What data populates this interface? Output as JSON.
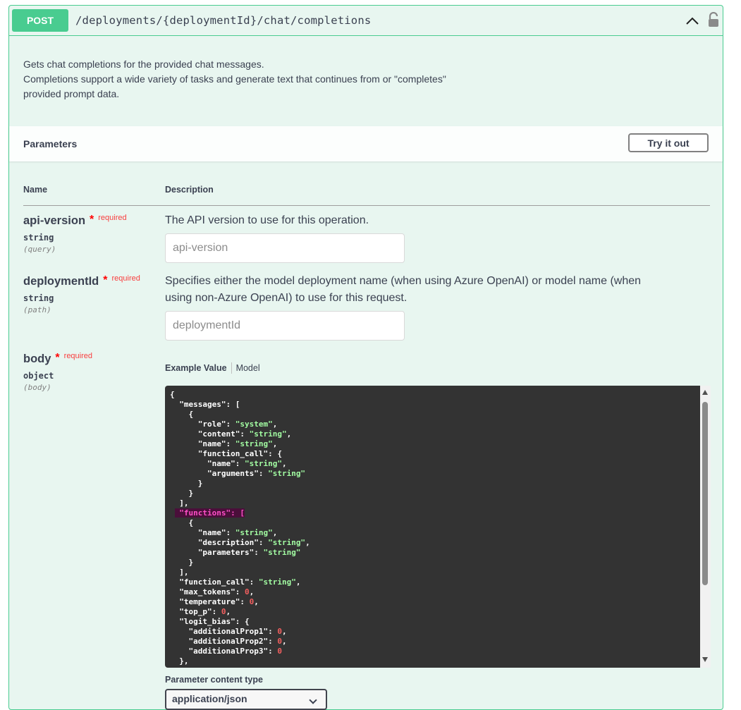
{
  "operation": {
    "method": "POST",
    "path": "/deployments/{deploymentId}/chat/completions",
    "description_lines": [
      "Gets chat completions for the provided chat messages.",
      "Completions support a wide variety of tasks and generate text that continues from or \"completes\"",
      "provided prompt data."
    ]
  },
  "parameters": {
    "title": "Parameters",
    "try_it_out_label": "Try it out",
    "col_name": "Name",
    "col_description": "Description",
    "required_star": "*",
    "required_label": "required",
    "items": [
      {
        "name": "api-version",
        "type": "string",
        "in": "(query)",
        "description": "The API version to use for this operation.",
        "placeholder": "api-version"
      },
      {
        "name": "deploymentId",
        "type": "string",
        "in": "(path)",
        "description_lines": [
          "Specifies either the model deployment name (when using Azure OpenAI) or model name (when",
          "using non-Azure OpenAI) to use for this request."
        ],
        "placeholder": "deploymentId"
      },
      {
        "name": "body",
        "type": "object",
        "in": "(body)"
      }
    ]
  },
  "body_example": {
    "tab_example": "Example Value",
    "tab_model": "Model",
    "lines": [
      "{",
      "  \"messages\": [",
      "    {",
      "      \"role\": \"system\",",
      "      \"content\": \"string\",",
      "      \"name\": \"string\",",
      "      \"function_call\": {",
      "        \"name\": \"string\",",
      "        \"arguments\": \"string\"",
      "      }",
      "    }",
      "  ],",
      "  \"functions\": [",
      "    {",
      "      \"name\": \"string\",",
      "      \"description\": \"string\",",
      "      \"parameters\": \"string\"",
      "    }",
      "  ],",
      "  \"function_call\": \"string\",",
      "  \"max_tokens\": 0,",
      "  \"temperature\": 0,",
      "  \"top_p\": 0,",
      "  \"logit_bias\": {",
      "    \"additionalProp1\": 0,",
      "    \"additionalProp2\": 0,",
      "    \"additionalProp3\": 0",
      "  },"
    ],
    "highlight_line": 12
  },
  "content_type": {
    "label": "Parameter content type",
    "selected": "application/json"
  },
  "colors": {
    "post": "#49cc90",
    "block_bg": "#e8f6f0",
    "code_bg": "#333333",
    "string": "#a2fca2",
    "number": "#f35f5f",
    "required": "#f93e3e"
  },
  "icons": [
    "chevron-up-icon",
    "lock-icon"
  ]
}
